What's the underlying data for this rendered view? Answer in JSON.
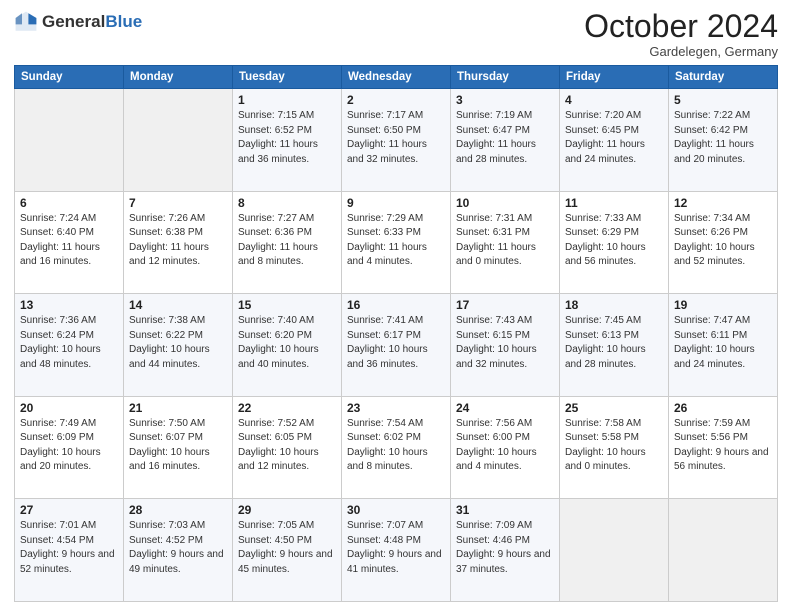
{
  "logo": {
    "general": "General",
    "blue": "Blue"
  },
  "header": {
    "month": "October 2024",
    "location": "Gardelegen, Germany"
  },
  "weekdays": [
    "Sunday",
    "Monday",
    "Tuesday",
    "Wednesday",
    "Thursday",
    "Friday",
    "Saturday"
  ],
  "weeks": [
    [
      {
        "day": "",
        "sunrise": "",
        "sunset": "",
        "daylight": ""
      },
      {
        "day": "",
        "sunrise": "",
        "sunset": "",
        "daylight": ""
      },
      {
        "day": "1",
        "sunrise": "Sunrise: 7:15 AM",
        "sunset": "Sunset: 6:52 PM",
        "daylight": "Daylight: 11 hours and 36 minutes."
      },
      {
        "day": "2",
        "sunrise": "Sunrise: 7:17 AM",
        "sunset": "Sunset: 6:50 PM",
        "daylight": "Daylight: 11 hours and 32 minutes."
      },
      {
        "day": "3",
        "sunrise": "Sunrise: 7:19 AM",
        "sunset": "Sunset: 6:47 PM",
        "daylight": "Daylight: 11 hours and 28 minutes."
      },
      {
        "day": "4",
        "sunrise": "Sunrise: 7:20 AM",
        "sunset": "Sunset: 6:45 PM",
        "daylight": "Daylight: 11 hours and 24 minutes."
      },
      {
        "day": "5",
        "sunrise": "Sunrise: 7:22 AM",
        "sunset": "Sunset: 6:42 PM",
        "daylight": "Daylight: 11 hours and 20 minutes."
      }
    ],
    [
      {
        "day": "6",
        "sunrise": "Sunrise: 7:24 AM",
        "sunset": "Sunset: 6:40 PM",
        "daylight": "Daylight: 11 hours and 16 minutes."
      },
      {
        "day": "7",
        "sunrise": "Sunrise: 7:26 AM",
        "sunset": "Sunset: 6:38 PM",
        "daylight": "Daylight: 11 hours and 12 minutes."
      },
      {
        "day": "8",
        "sunrise": "Sunrise: 7:27 AM",
        "sunset": "Sunset: 6:36 PM",
        "daylight": "Daylight: 11 hours and 8 minutes."
      },
      {
        "day": "9",
        "sunrise": "Sunrise: 7:29 AM",
        "sunset": "Sunset: 6:33 PM",
        "daylight": "Daylight: 11 hours and 4 minutes."
      },
      {
        "day": "10",
        "sunrise": "Sunrise: 7:31 AM",
        "sunset": "Sunset: 6:31 PM",
        "daylight": "Daylight: 11 hours and 0 minutes."
      },
      {
        "day": "11",
        "sunrise": "Sunrise: 7:33 AM",
        "sunset": "Sunset: 6:29 PM",
        "daylight": "Daylight: 10 hours and 56 minutes."
      },
      {
        "day": "12",
        "sunrise": "Sunrise: 7:34 AM",
        "sunset": "Sunset: 6:26 PM",
        "daylight": "Daylight: 10 hours and 52 minutes."
      }
    ],
    [
      {
        "day": "13",
        "sunrise": "Sunrise: 7:36 AM",
        "sunset": "Sunset: 6:24 PM",
        "daylight": "Daylight: 10 hours and 48 minutes."
      },
      {
        "day": "14",
        "sunrise": "Sunrise: 7:38 AM",
        "sunset": "Sunset: 6:22 PM",
        "daylight": "Daylight: 10 hours and 44 minutes."
      },
      {
        "day": "15",
        "sunrise": "Sunrise: 7:40 AM",
        "sunset": "Sunset: 6:20 PM",
        "daylight": "Daylight: 10 hours and 40 minutes."
      },
      {
        "day": "16",
        "sunrise": "Sunrise: 7:41 AM",
        "sunset": "Sunset: 6:17 PM",
        "daylight": "Daylight: 10 hours and 36 minutes."
      },
      {
        "day": "17",
        "sunrise": "Sunrise: 7:43 AM",
        "sunset": "Sunset: 6:15 PM",
        "daylight": "Daylight: 10 hours and 32 minutes."
      },
      {
        "day": "18",
        "sunrise": "Sunrise: 7:45 AM",
        "sunset": "Sunset: 6:13 PM",
        "daylight": "Daylight: 10 hours and 28 minutes."
      },
      {
        "day": "19",
        "sunrise": "Sunrise: 7:47 AM",
        "sunset": "Sunset: 6:11 PM",
        "daylight": "Daylight: 10 hours and 24 minutes."
      }
    ],
    [
      {
        "day": "20",
        "sunrise": "Sunrise: 7:49 AM",
        "sunset": "Sunset: 6:09 PM",
        "daylight": "Daylight: 10 hours and 20 minutes."
      },
      {
        "day": "21",
        "sunrise": "Sunrise: 7:50 AM",
        "sunset": "Sunset: 6:07 PM",
        "daylight": "Daylight: 10 hours and 16 minutes."
      },
      {
        "day": "22",
        "sunrise": "Sunrise: 7:52 AM",
        "sunset": "Sunset: 6:05 PM",
        "daylight": "Daylight: 10 hours and 12 minutes."
      },
      {
        "day": "23",
        "sunrise": "Sunrise: 7:54 AM",
        "sunset": "Sunset: 6:02 PM",
        "daylight": "Daylight: 10 hours and 8 minutes."
      },
      {
        "day": "24",
        "sunrise": "Sunrise: 7:56 AM",
        "sunset": "Sunset: 6:00 PM",
        "daylight": "Daylight: 10 hours and 4 minutes."
      },
      {
        "day": "25",
        "sunrise": "Sunrise: 7:58 AM",
        "sunset": "Sunset: 5:58 PM",
        "daylight": "Daylight: 10 hours and 0 minutes."
      },
      {
        "day": "26",
        "sunrise": "Sunrise: 7:59 AM",
        "sunset": "Sunset: 5:56 PM",
        "daylight": "Daylight: 9 hours and 56 minutes."
      }
    ],
    [
      {
        "day": "27",
        "sunrise": "Sunrise: 7:01 AM",
        "sunset": "Sunset: 4:54 PM",
        "daylight": "Daylight: 9 hours and 52 minutes."
      },
      {
        "day": "28",
        "sunrise": "Sunrise: 7:03 AM",
        "sunset": "Sunset: 4:52 PM",
        "daylight": "Daylight: 9 hours and 49 minutes."
      },
      {
        "day": "29",
        "sunrise": "Sunrise: 7:05 AM",
        "sunset": "Sunset: 4:50 PM",
        "daylight": "Daylight: 9 hours and 45 minutes."
      },
      {
        "day": "30",
        "sunrise": "Sunrise: 7:07 AM",
        "sunset": "Sunset: 4:48 PM",
        "daylight": "Daylight: 9 hours and 41 minutes."
      },
      {
        "day": "31",
        "sunrise": "Sunrise: 7:09 AM",
        "sunset": "Sunset: 4:46 PM",
        "daylight": "Daylight: 9 hours and 37 minutes."
      },
      {
        "day": "",
        "sunrise": "",
        "sunset": "",
        "daylight": ""
      },
      {
        "day": "",
        "sunrise": "",
        "sunset": "",
        "daylight": ""
      }
    ]
  ]
}
